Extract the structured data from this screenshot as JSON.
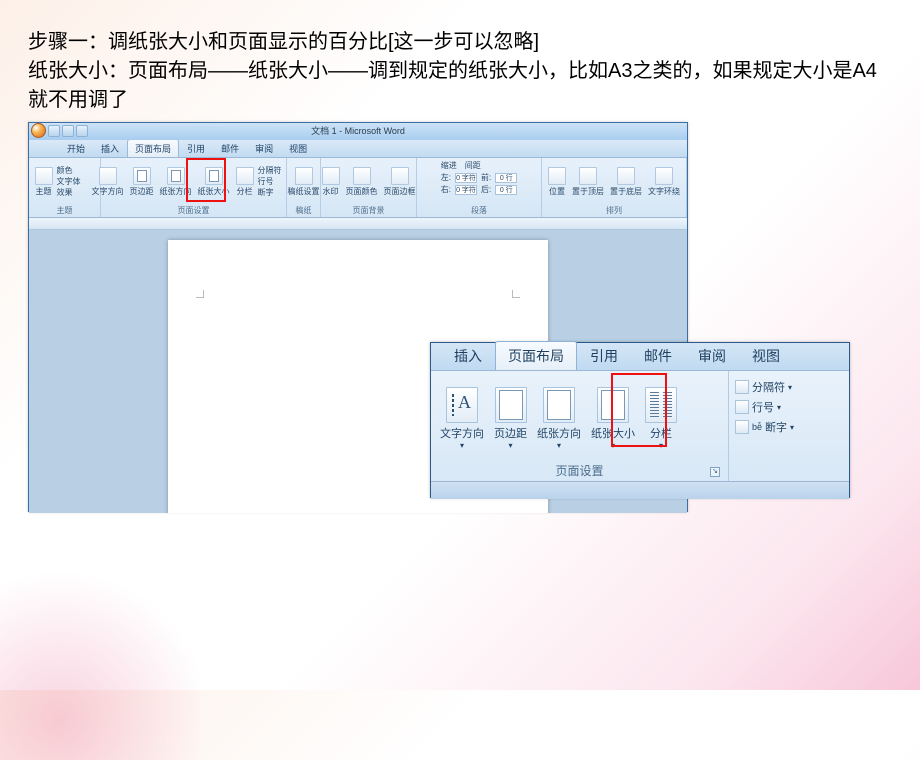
{
  "caption_line1": "步骤一：调纸张大小和页面显示的百分比[这一步可以忽略]",
  "caption_line2": "纸张大小：页面布局——纸张大小——调到规定的纸张大小，比如A3之类的，如果规定大小是A4就不用调了",
  "word": {
    "title": "文档 1 - Microsoft Word",
    "tabs": [
      "开始",
      "插入",
      "页面布局",
      "引用",
      "邮件",
      "审阅",
      "视图"
    ],
    "active_tab": 2,
    "groups": {
      "themes": {
        "label": "主题",
        "btn_theme": "主题",
        "colors": "颜色",
        "fonts": "文字体",
        "effects": "效果"
      },
      "page_setup": {
        "label": "页面设置",
        "text_direction": "文字方向",
        "margins": "页边距",
        "orientation": "纸张方向",
        "size": "纸张大小",
        "columns": "分栏",
        "breaks": "分隔符",
        "line_numbers": "行号",
        "hyphenation": "断字"
      },
      "manuscript": {
        "label": "稿纸",
        "btn": "稿纸设置"
      },
      "background": {
        "label": "页面背景",
        "watermark": "水印",
        "color": "页面颜色",
        "borders": "页面边框"
      },
      "paragraph": {
        "label": "段落",
        "indent_label": "缩进",
        "indent_left": "左:",
        "indent_left_val": "0 字符",
        "indent_right": "右:",
        "indent_right_val": "0 字符",
        "spacing_label": "间距",
        "spacing_before": "前:",
        "spacing_before_val": "0 行",
        "spacing_after": "后:",
        "spacing_after_val": "0 行"
      },
      "arrange": {
        "label": "排列",
        "position": "位置",
        "front": "置于顶层",
        "back": "置于底层",
        "wrap": "文字环绕"
      }
    }
  },
  "inset": {
    "tabs": [
      "插入",
      "页面布局",
      "引用",
      "邮件",
      "审阅",
      "视图"
    ],
    "active_tab": 1,
    "page_setup": {
      "label": "页面设置",
      "text_direction": "文字方向",
      "margins": "页边距",
      "orientation": "纸张方向",
      "size": "纸张大小",
      "columns": "分栏"
    },
    "breaks": "分隔符",
    "line_numbers": "行号",
    "hyphenation": "断字"
  }
}
